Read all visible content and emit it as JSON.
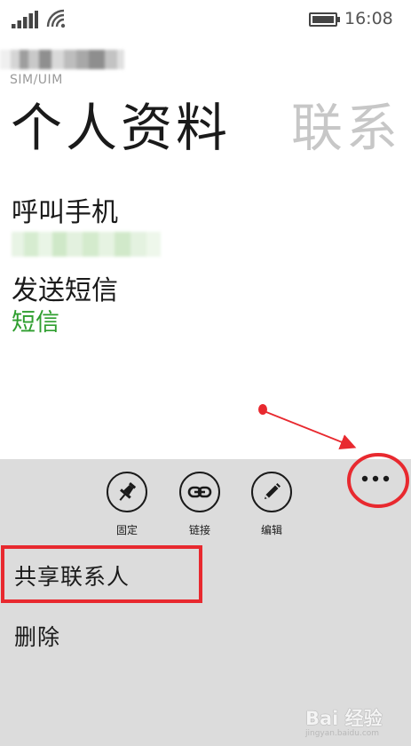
{
  "status_bar": {
    "time": "16:08",
    "signal_icon": "signal-bars-icon",
    "wifi_icon": "wifi-icon",
    "battery_icon": "battery-icon"
  },
  "header": {
    "account_label": "SIM/UIM",
    "pivot": [
      {
        "label": "个人资料",
        "active": true
      },
      {
        "label": "联系",
        "active": false
      }
    ]
  },
  "actions": [
    {
      "title": "呼叫手机",
      "subtitle": ""
    },
    {
      "title": "发送短信",
      "subtitle": "短信"
    }
  ],
  "app_bar": {
    "background": "#dcdcdc",
    "buttons": [
      {
        "label": "固定",
        "icon": "pin-icon"
      },
      {
        "label": "链接",
        "icon": "link-icon"
      },
      {
        "label": "编辑",
        "icon": "edit-icon"
      }
    ],
    "more_icon": "ellipsis-icon",
    "menu_items": [
      "共享联系人",
      "删除"
    ]
  },
  "colors": {
    "accent": "#2e9e2e",
    "annotation": "#e8292f"
  },
  "watermark": {
    "text": "Bai 经验",
    "url": "jingyan.baidu.com"
  }
}
